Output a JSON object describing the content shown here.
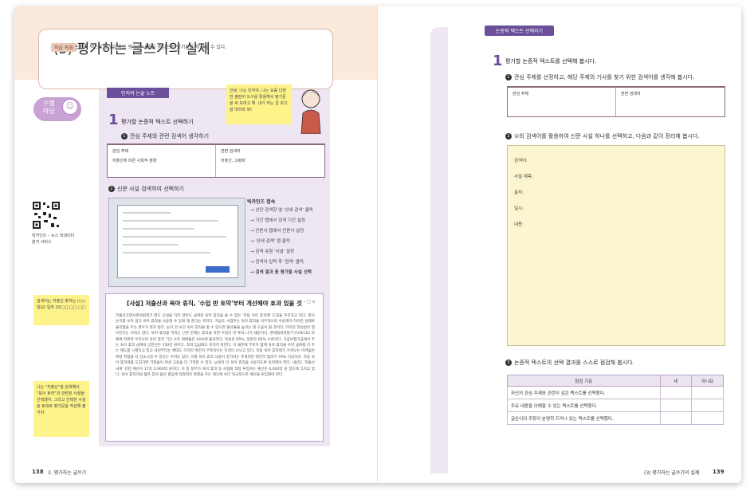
{
  "left_page": {
    "title": "(3) 평가하는 글쓰기의 실제",
    "goal_badge": "학습 목표",
    "goal_text": "논증적 텍스트를 요약하고 평가한 내용을 중심으로 평가문을 작성할 수 있다.",
    "practice_badge": "수행\n마당",
    "note_tag": "민지의 논술 노트",
    "sticky_top": "안녕, 나는 민지야. 나는 요즘 다양한 출판이 도구를 활용해서 평가문을 써 보려고 해. 내가 하는 걸 보고 잘 따라와 봐!",
    "section1_title": "평가할 논증적 텍스트 선택하기",
    "q1": "관심 주제와 관련 검색어 생각하기",
    "table": {
      "col1_header": "관심 주제",
      "col1_value": "저출산에 따른 사회적 영향",
      "col2_header": "관련 검색어",
      "col2_value": "저출산, 고령화"
    },
    "q2": "신문 사설 검색하여 선택하기",
    "steps_title": "빅카인즈 접속",
    "steps": [
      "→ 상단 검색창 옆 '상세 검색' 클릭",
      "→ 기간 탭에서 검색 기간 설정",
      "→ 언론사 탭에서 언론사 설정",
      "→ '상세 검색' 탭 클릭",
      "→ 검색 유형 '사설' 설정",
      "→ 검색어 입력 후 '검색' 클릭",
      "→ 검색 결과 중 평가할 사설 선택"
    ],
    "qr_label": "빅카인즈 – 뉴스 빅데이터 분석 서비스",
    "sticky_mid": "검색어는 저출산 출처는 (○○일보) 일자 20□□.□□.□□",
    "sticky_bottom": "나는 \"저출산\"을 검색해서 \"육아 휴직\"과 관련된 사설을 선택했어. 그리고 선택한 사설을 토대로 평가문을 작성해 볼 거야.",
    "article": {
      "title": "[사설] 저출산과 육아 휴직, '수입 반 토막'부터 개선해야 효과 있을 것",
      "controls": "– □ ×",
      "body": "저출산고령사회위원회가 별도 신설을 하지 않아도 급여로 육아 휴직을 쓸 수 있는 '자동 육아 휴직제' 도입을 추진하고 있다. 회사 눈치를 보지 않고 육아 휴직을 사용할 수 있게 해 준다는 취지다. 지금도 사업주는 육아 휴직을 의무적으로 수용해야 하지만 실제로 불리함을 주는 경우가 적지 않다. 눈치 안 보고 육아 휴직을 할 수 있으면 출산율을 높이는 데 도움이 될 것이다. 하지만 현실성이 떨어진다는 지적도 많다. 육아 휴직을 꺼리는 근본 문제는 휴직을 하면 수입이 반 토막 나기 때문이다. 경제협력개발기구(OECD) 자료에 따르면 우리나라 육아 휴직 기간 소득 대체율은 44%에 불과하다. 독일은 65%, 일본은 60% 수준이다. 고용보험기금에서 주는 육아 휴직 급여의 상한선은 150만 원이다. 최저 임금에도 미치지 못한다. 이 때문에 부모가 함께 육아 휴직을 쓰면 급여를 더 주는 제도를 시행하고 있고 내년부터는 확대도 하지만 여전히 부족하다는 지적이 나오고 있다. 자동 육아 휴직제가 가져오는 어려움은 여성 취업을 더 감소시킬 수 있다는 우려도 있다. 이를 육아 휴직 사용이 증가하는 추세지만 여전히 엄마가 70% 이상이다. 자동 육아 휴직제를 도입하면 기업들이 여성 고용을 더 기피할 수 있다. 남성이 더 육아 휴직을 사용하도록 독려해야 한다. 내년도 '저출산 극복' 관련 예산이 17조 5,900억 원이다. 이 중 정부가 육아 휴직 등 사업에 직접 투입하는 예산은 4,000억 원 정도에 그치고 있다. 육아 휴직처럼 젊은 층의 출산 결심에 직접적인 영향을 주는 제도에 보다 적극적으로 예산을 투입해야 한다."
    },
    "page_number": "138",
    "page_chapter": "3. 평가하는 글쓰기"
  },
  "right_page": {
    "tag": "논증적 텍스트 선택하기",
    "section1_title": "평가할 논증적 텍스트를 선택해 봅시다.",
    "q1": "관심 주제를 선정하고, 해당 주제의 기사를 찾기 위한 검색어를 생각해 봅시다.",
    "table": {
      "col1_header": "관심 주제",
      "col2_header": "관련 검색어"
    },
    "q2": "①의 검색어를 활용하여 신문 사설 하나를 선택하고, 다음과 같이 정리해 봅시다.",
    "fields": [
      "검색어:",
      "사설 제목:",
      "출처:",
      "일시:",
      "내용:"
    ],
    "q3": "논증적 텍스트의 선택 결과를 스스로 점검해 봅시다.",
    "checklist": {
      "headers": [
        "점검 기준",
        "네",
        "아니요"
      ],
      "rows": [
        "자신의 관심 주제와 관련이 깊은 텍스트를 선택했다.",
        "주요 내용을 이해할 수 있는 텍스트를 선택했다.",
        "글쓴이의 주장이 분명히 드러나 있는 텍스트를 선택했다."
      ]
    },
    "page_chapter": "(3) 평가하는 글쓰기의 실제",
    "page_number": "139"
  }
}
